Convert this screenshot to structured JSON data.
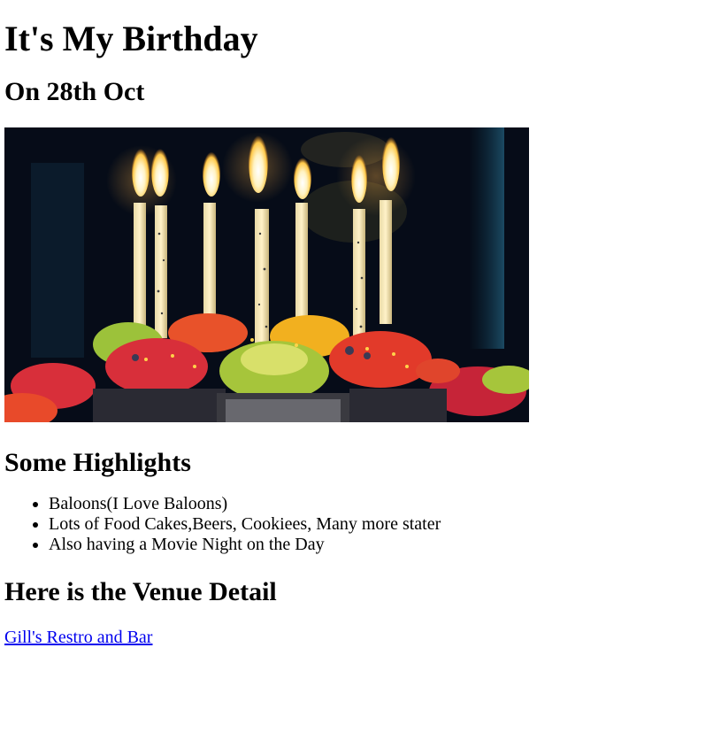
{
  "page": {
    "title": "It's My Birthday",
    "subtitle": "On 28th Oct"
  },
  "hero_image": {
    "alt": "birthday-cupcakes-with-candles"
  },
  "highlights": {
    "heading": "Some Highlights",
    "items": [
      "Baloons(I Love Baloons)",
      "Lots of Food Cakes,Beers, Cookiees, Many more stater",
      "Also having a Movie Night on the Day"
    ]
  },
  "venue": {
    "heading": "Here is the Venue Detail",
    "link_text": "Gill's Restro and Bar",
    "link_color": "#0000ee"
  }
}
